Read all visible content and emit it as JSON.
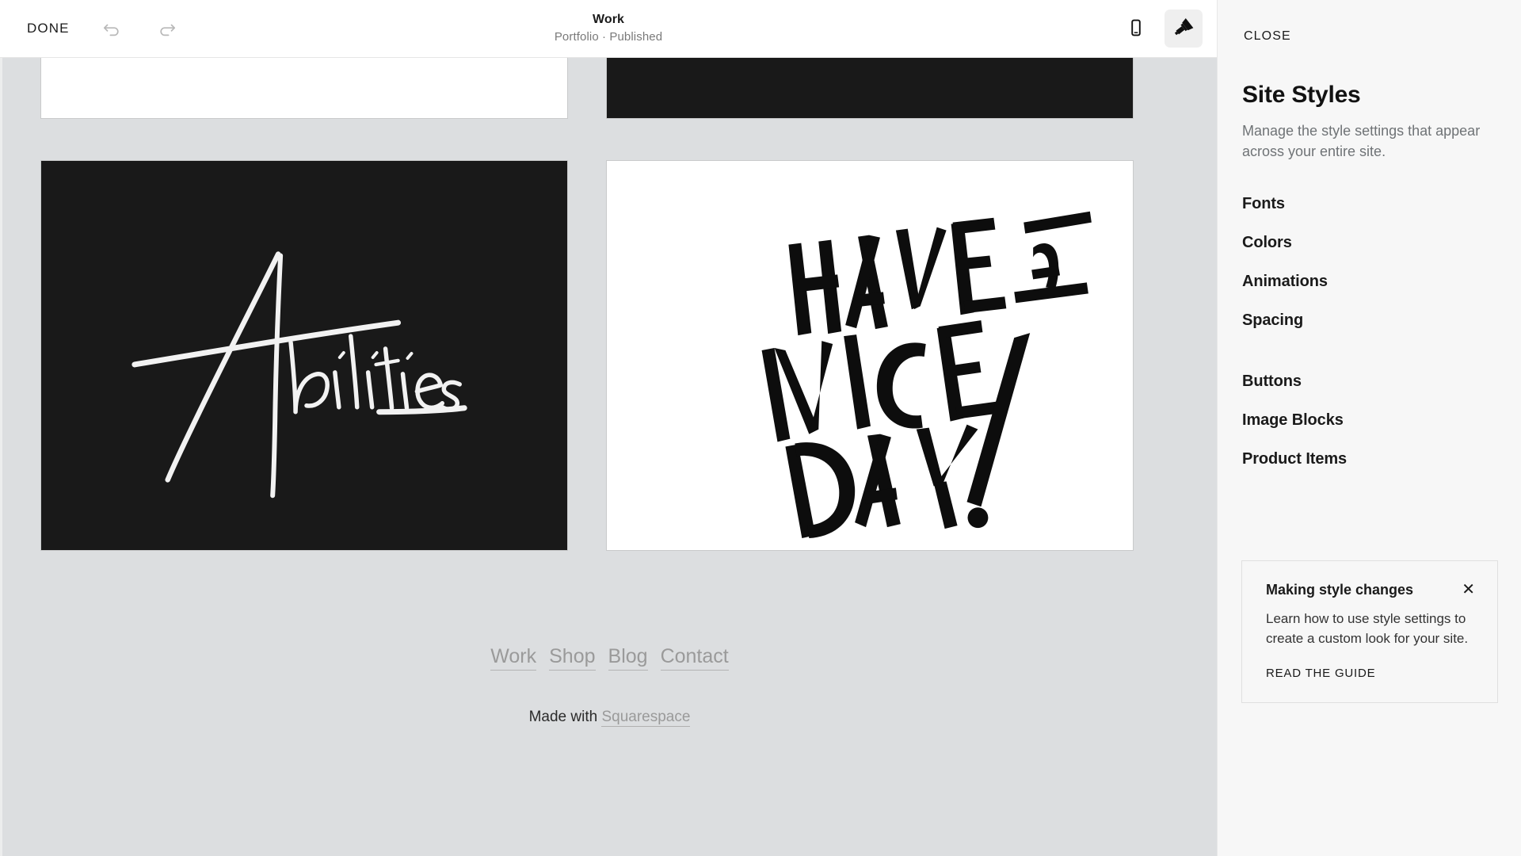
{
  "topbar": {
    "done_label": "DONE",
    "undo_icon": "undo-icon",
    "redo_icon": "redo-icon",
    "title": "Work",
    "subtitle": "Portfolio · Published",
    "mobile_view_icon": "mobile-device-icon",
    "styles_icon": "paintbrush-icon"
  },
  "canvas": {
    "tiles_row1": [
      {
        "name": "image-block-top-left",
        "bg": "white",
        "art": "none"
      },
      {
        "name": "image-block-top-right",
        "bg": "black",
        "art": "none"
      }
    ],
    "tiles_row2": [
      {
        "name": "image-block-abilities",
        "bg": "black",
        "art": "abilities-script-lettering",
        "alt": "Abilities"
      },
      {
        "name": "image-block-have-a-nice-day",
        "bg": "white",
        "art": "have-a-nice-day-lettering",
        "alt": "HAVE A NICE DAY."
      }
    ]
  },
  "footer": {
    "nav": [
      {
        "label": "Work"
      },
      {
        "label": "Shop"
      },
      {
        "label": "Blog"
      },
      {
        "label": "Contact"
      }
    ],
    "made_with_prefix": "Made with ",
    "made_with_brand": "Squarespace"
  },
  "scrollbar": {
    "up_icon": "scroll-up-arrow-icon",
    "down_icon": "scroll-down-arrow-icon"
  },
  "panel": {
    "close_label": "CLOSE",
    "heading": "Site Styles",
    "description": "Manage the style settings that appear across your entire site.",
    "menu_group_one": [
      {
        "label": "Fonts"
      },
      {
        "label": "Colors"
      },
      {
        "label": "Animations"
      },
      {
        "label": "Spacing"
      }
    ],
    "menu_group_two": [
      {
        "label": "Buttons"
      },
      {
        "label": "Image Blocks"
      },
      {
        "label": "Product Items"
      }
    ],
    "tip": {
      "title": "Making style changes",
      "close_icon": "close-x-icon",
      "body": "Learn how to use style settings to create a custom look for your site.",
      "link_label": "READ THE GUIDE"
    }
  },
  "colors": {
    "canvas_bg": "#dcdee0",
    "panel_bg": "#f7f7f7",
    "tile_black": "#191919",
    "tile_white": "#ffffff",
    "accent_text": "#1a1a1a",
    "muted_text": "#6f7376",
    "footer_link": "#9a9a9a",
    "scroll_thumb": "#c0c0c0",
    "active_button_bg": "#efefef"
  }
}
